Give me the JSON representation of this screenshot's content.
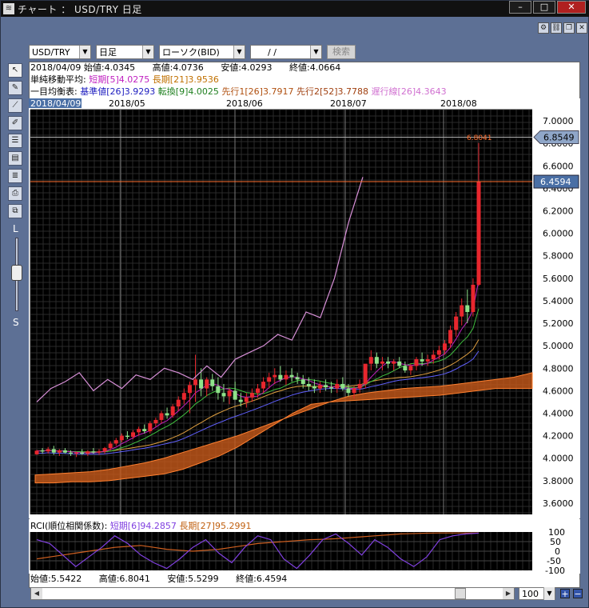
{
  "window": {
    "title": "チャート ： USD/TRY 日足",
    "min": "–",
    "max": "□",
    "close": "✕"
  },
  "controls": {
    "symbol": "USD/TRY",
    "timeframe": "日足",
    "chart_type": "ローソク(BID)",
    "date": "/ /",
    "search": "検索"
  },
  "info": {
    "date": "2018/04/09",
    "open": "始値:4.0345",
    "high": "高値:4.0736",
    "low": "安値:4.0293",
    "close": "終値:4.0664",
    "sma_label": "単純移動平均:",
    "sma_short": "短期[5]4.0275",
    "sma_long": "長期[21]3.9536",
    "ichi_label": "一目均衡表:",
    "ichi_base": "基準値[26]3.9293",
    "ichi_conv": "転換[9]4.0025",
    "ichi_span1": "先行1[26]3.7917",
    "ichi_span2": "先行2[52]3.7788",
    "ichi_lag": "遅行線[26]4.3643"
  },
  "rci": {
    "label": "RCI(順位相関係数):",
    "short": "短期[6]94.2857",
    "long": "長期[27]95.2991"
  },
  "footer": {
    "open": "始値:5.5422",
    "high": "高値:6.8041",
    "low": "安値:5.5299",
    "close": "終値:6.4594",
    "zoom": "100"
  },
  "sidebar": {
    "zoom_large": "L",
    "zoom_small": "S"
  },
  "colors": {
    "bg": "#000000",
    "up": "#e8272e",
    "down": "#8fe38a",
    "sma_short": "#c020c0",
    "sma_long": "#e0a040",
    "base": "#6060ff",
    "conv": "#40c040",
    "cloud": "#c85a1a",
    "lag": "#d890d8",
    "rci_short": "#8040e0",
    "rci_long": "#d06020",
    "accent_label": "#4a6fa5"
  },
  "chart_data": {
    "type": "candlestick",
    "title": "USD/TRY 日足",
    "xlabel": "",
    "ylabel": "",
    "x_ticks": [
      "2018/04/09",
      "2018/05",
      "2018/06",
      "2018/07",
      "2018/08"
    ],
    "y_ticks": [
      "7.0000",
      "6.8000",
      "6.6000",
      "6.4000",
      "6.2000",
      "6.0000",
      "5.8000",
      "5.6000",
      "5.4000",
      "5.2000",
      "5.0000",
      "4.8000",
      "4.6000",
      "4.4000",
      "4.2000",
      "4.0000",
      "3.8000",
      "3.6000"
    ],
    "ylim": [
      3.5,
      7.1
    ],
    "high_marker": "6.8041",
    "price_labels": [
      "6.8549",
      "6.4594"
    ],
    "rci_ticks": [
      "100",
      "50",
      "0",
      "-50",
      "-100"
    ],
    "rci_ylim": [
      -100,
      100
    ],
    "ohlc": [
      [
        4.0345,
        4.0736,
        4.0293,
        4.0664
      ],
      [
        4.07,
        4.09,
        4.04,
        4.06
      ],
      [
        4.06,
        4.1,
        4.04,
        4.08
      ],
      [
        4.08,
        4.11,
        4.03,
        4.05
      ],
      [
        4.05,
        4.08,
        4.02,
        4.07
      ],
      [
        4.07,
        4.09,
        4.04,
        4.05
      ],
      [
        4.05,
        4.07,
        4.02,
        4.04
      ],
      [
        4.04,
        4.06,
        4.01,
        4.05
      ],
      [
        4.05,
        4.08,
        4.03,
        4.04
      ],
      [
        4.04,
        4.07,
        4.02,
        4.06
      ],
      [
        4.06,
        4.09,
        4.04,
        4.05
      ],
      [
        4.05,
        4.08,
        4.03,
        4.06
      ],
      [
        4.06,
        4.1,
        4.04,
        4.09
      ],
      [
        4.09,
        4.15,
        4.07,
        4.13
      ],
      [
        4.13,
        4.18,
        4.11,
        4.16
      ],
      [
        4.16,
        4.22,
        4.14,
        4.2
      ],
      [
        4.2,
        4.24,
        4.17,
        4.19
      ],
      [
        4.19,
        4.25,
        4.17,
        4.23
      ],
      [
        4.23,
        4.28,
        4.2,
        4.26
      ],
      [
        4.26,
        4.3,
        4.22,
        4.24
      ],
      [
        4.24,
        4.33,
        4.22,
        4.31
      ],
      [
        4.31,
        4.36,
        4.28,
        4.34
      ],
      [
        4.34,
        4.42,
        4.31,
        4.4
      ],
      [
        4.4,
        4.45,
        4.35,
        4.38
      ],
      [
        4.38,
        4.48,
        4.36,
        4.46
      ],
      [
        4.46,
        4.55,
        4.42,
        4.52
      ],
      [
        4.52,
        4.62,
        4.48,
        4.58
      ],
      [
        4.58,
        4.68,
        4.4,
        4.65
      ],
      [
        4.65,
        4.92,
        4.5,
        4.7
      ],
      [
        4.7,
        4.8,
        4.55,
        4.62
      ],
      [
        4.62,
        4.72,
        4.55,
        4.7
      ],
      [
        4.7,
        4.75,
        4.6,
        4.64
      ],
      [
        4.64,
        4.72,
        4.52,
        4.58
      ],
      [
        4.58,
        4.66,
        4.5,
        4.55
      ],
      [
        4.55,
        4.62,
        4.48,
        4.6
      ],
      [
        4.6,
        4.68,
        4.55,
        4.52
      ],
      [
        4.52,
        4.58,
        4.46,
        4.5
      ],
      [
        4.5,
        4.58,
        4.45,
        4.54
      ],
      [
        4.54,
        4.62,
        4.5,
        4.58
      ],
      [
        4.58,
        4.66,
        4.54,
        4.62
      ],
      [
        4.62,
        4.72,
        4.58,
        4.68
      ],
      [
        4.68,
        4.76,
        4.62,
        4.72
      ],
      [
        4.72,
        4.8,
        4.66,
        4.74
      ],
      [
        4.74,
        4.82,
        4.68,
        4.7
      ],
      [
        4.7,
        4.78,
        4.65,
        4.74
      ],
      [
        4.74,
        4.8,
        4.68,
        4.72
      ],
      [
        4.72,
        4.76,
        4.66,
        4.7
      ],
      [
        4.7,
        4.74,
        4.62,
        4.66
      ],
      [
        4.66,
        4.72,
        4.6,
        4.64
      ],
      [
        4.64,
        4.7,
        4.58,
        4.62
      ],
      [
        4.62,
        4.68,
        4.58,
        4.65
      ],
      [
        4.65,
        4.7,
        4.6,
        4.63
      ],
      [
        4.63,
        4.68,
        4.58,
        4.62
      ],
      [
        4.62,
        4.7,
        4.58,
        4.66
      ],
      [
        4.66,
        4.72,
        4.6,
        4.62
      ],
      [
        4.62,
        4.66,
        4.55,
        4.58
      ],
      [
        4.58,
        4.64,
        4.53,
        4.62
      ],
      [
        4.62,
        4.7,
        4.58,
        4.66
      ],
      [
        4.66,
        4.78,
        4.62,
        4.84
      ],
      [
        4.84,
        4.96,
        4.78,
        4.9
      ],
      [
        4.9,
        4.94,
        4.8,
        4.84
      ],
      [
        4.84,
        4.9,
        4.78,
        4.86
      ],
      [
        4.86,
        4.9,
        4.8,
        4.84
      ],
      [
        4.84,
        4.88,
        4.78,
        4.86
      ],
      [
        4.86,
        4.9,
        4.8,
        4.82
      ],
      [
        4.82,
        4.86,
        4.76,
        4.78
      ],
      [
        4.78,
        4.84,
        4.74,
        4.82
      ],
      [
        4.82,
        4.9,
        4.78,
        4.88
      ],
      [
        4.88,
        4.94,
        4.82,
        4.86
      ],
      [
        4.86,
        4.92,
        4.82,
        4.88
      ],
      [
        4.88,
        4.96,
        4.84,
        4.92
      ],
      [
        4.92,
        5.0,
        4.88,
        4.96
      ],
      [
        4.96,
        5.05,
        4.92,
        5.02
      ],
      [
        5.02,
        5.18,
        4.98,
        5.14
      ],
      [
        5.14,
        5.3,
        5.08,
        5.26
      ],
      [
        5.26,
        5.42,
        5.18,
        5.36
      ],
      [
        5.36,
        5.5,
        5.2,
        5.3
      ],
      [
        5.3,
        5.6,
        5.26,
        5.5422
      ],
      [
        5.5422,
        6.8041,
        5.5299,
        6.4594
      ]
    ],
    "cloud_top": [
      3.85,
      3.86,
      3.87,
      3.88,
      3.9,
      3.93,
      3.96,
      4.0,
      4.05,
      4.1,
      4.15,
      4.2,
      4.26,
      4.32,
      4.38,
      4.44,
      4.5,
      4.55,
      4.58,
      4.6,
      4.62,
      4.63,
      4.64,
      4.66,
      4.68,
      4.7,
      4.72,
      4.76
    ],
    "cloud_bottom": [
      3.78,
      3.78,
      3.79,
      3.79,
      3.8,
      3.82,
      3.84,
      3.86,
      3.9,
      3.96,
      4.02,
      4.1,
      4.2,
      4.3,
      4.4,
      4.48,
      4.5,
      4.51,
      4.52,
      4.53,
      4.54,
      4.55,
      4.56,
      4.58,
      4.6,
      4.62,
      4.62,
      4.62
    ],
    "lag_line": [
      4.5,
      4.62,
      4.68,
      4.76,
      4.6,
      4.7,
      4.62,
      4.74,
      4.7,
      4.8,
      4.76,
      4.7,
      4.82,
      4.72,
      4.88,
      4.94,
      5.0,
      5.1,
      5.05,
      5.3,
      5.25,
      5.6,
      6.1,
      6.5
    ],
    "rci_short": [
      60,
      40,
      -20,
      -80,
      -30,
      20,
      80,
      40,
      -20,
      -60,
      -90,
      -40,
      20,
      60,
      -10,
      -60,
      20,
      80,
      60,
      -40,
      -90,
      -20,
      60,
      90,
      40,
      -20,
      60,
      20,
      -40,
      -80,
      -30,
      60,
      80,
      90,
      94
    ],
    "rci_long": [
      -40,
      -30,
      -20,
      -10,
      0,
      10,
      20,
      25,
      30,
      20,
      10,
      5,
      0,
      5,
      10,
      20,
      30,
      40,
      45,
      50,
      55,
      60,
      62,
      65,
      70,
      75,
      80,
      85,
      90,
      92,
      94,
      95,
      95,
      95,
      95
    ]
  }
}
